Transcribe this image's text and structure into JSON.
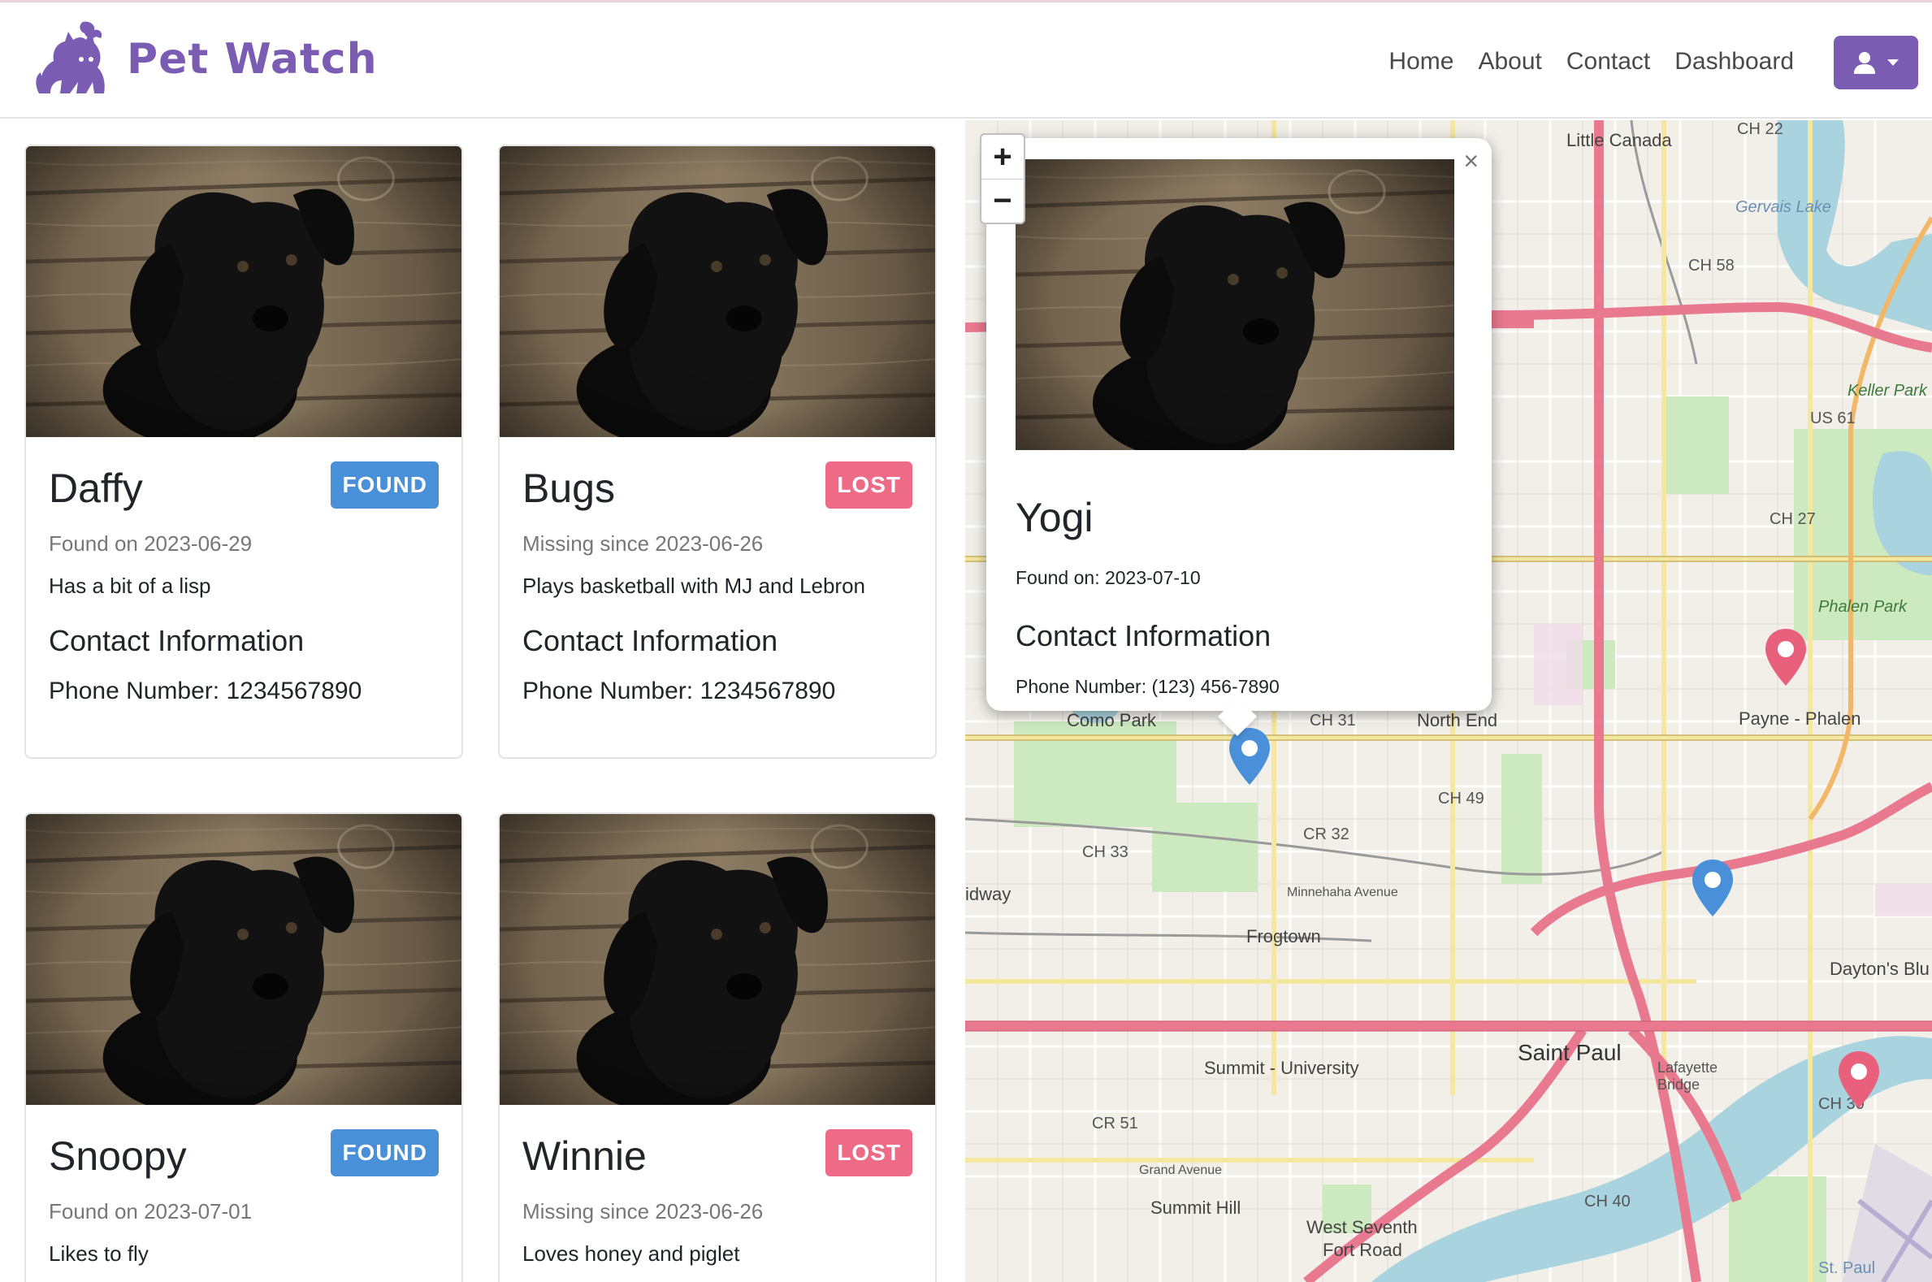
{
  "app": {
    "brand": "Pet Watch"
  },
  "nav": {
    "home": "Home",
    "about": "About",
    "contact": "Contact",
    "dashboard": "Dashboard"
  },
  "cards": [
    {
      "name": "Daffy",
      "status": "FOUND",
      "date": "Found on 2023-06-29",
      "description": "Has a bit of a lisp",
      "contact_heading": "Contact Information",
      "phone": "Phone Number: 1234567890"
    },
    {
      "name": "Bugs",
      "status": "LOST",
      "date": "Missing since 2023-06-26",
      "description": "Plays basketball with MJ and Lebron",
      "contact_heading": "Contact Information",
      "phone": "Phone Number: 1234567890"
    },
    {
      "name": "Snoopy",
      "status": "FOUND",
      "date": "Found on 2023-07-01",
      "description": "Likes to fly"
    },
    {
      "name": "Winnie",
      "status": "LOST",
      "date": "Missing since 2023-06-26",
      "description": "Loves honey and piglet"
    }
  ],
  "map": {
    "zoom_in": "+",
    "zoom_out": "−",
    "popup": {
      "close": "×",
      "name": "Yogi",
      "date": "Found on: 2023-07-10",
      "contact_heading": "Contact Information",
      "phone": "Phone Number: (123) 456-7890"
    },
    "labels": {
      "little_canada": "Little Canada",
      "ch22": "CH 22",
      "gervais_lake": "Gervais Lake",
      "ch58": "CH 58",
      "keller_park": "Keller Park",
      "us61": "US 61",
      "ch27": "CH 27",
      "phalen_park": "Phalen Park",
      "como_park": "Como Park",
      "ch31": "CH 31",
      "north_end": "North End",
      "payne_phalen": "Payne - Phalen",
      "ch49": "CH 49",
      "cr32": "CR 32",
      "ch33": "CH 33",
      "midway": "idway",
      "minnehaha": "Minnehaha Avenue",
      "frogtown": "Frogtown",
      "daytons": "Dayton's Blu",
      "summit_university": "Summit - University",
      "saint_paul": "Saint Paul",
      "lafayette": "Lafayette Bridge",
      "cr51": "CR 51",
      "grand_ave": "Grand Avenue",
      "summit_hill": "Summit Hill",
      "west_seventh": "West Seventh",
      "fort_road": "Fort Road",
      "ch40": "CH 40",
      "st_paul_airport": "St. Paul",
      "ch30": "CH 30"
    }
  },
  "colors": {
    "brand": "#7b5cb3",
    "found": "#4a90d9",
    "lost": "#ee6b87",
    "pin_blue": "#4a90d9",
    "pin_red": "#e8607c"
  },
  "icons": [
    "pet-logo-icon",
    "user-icon",
    "caret-down-icon",
    "map-pin-icon",
    "close-icon"
  ]
}
